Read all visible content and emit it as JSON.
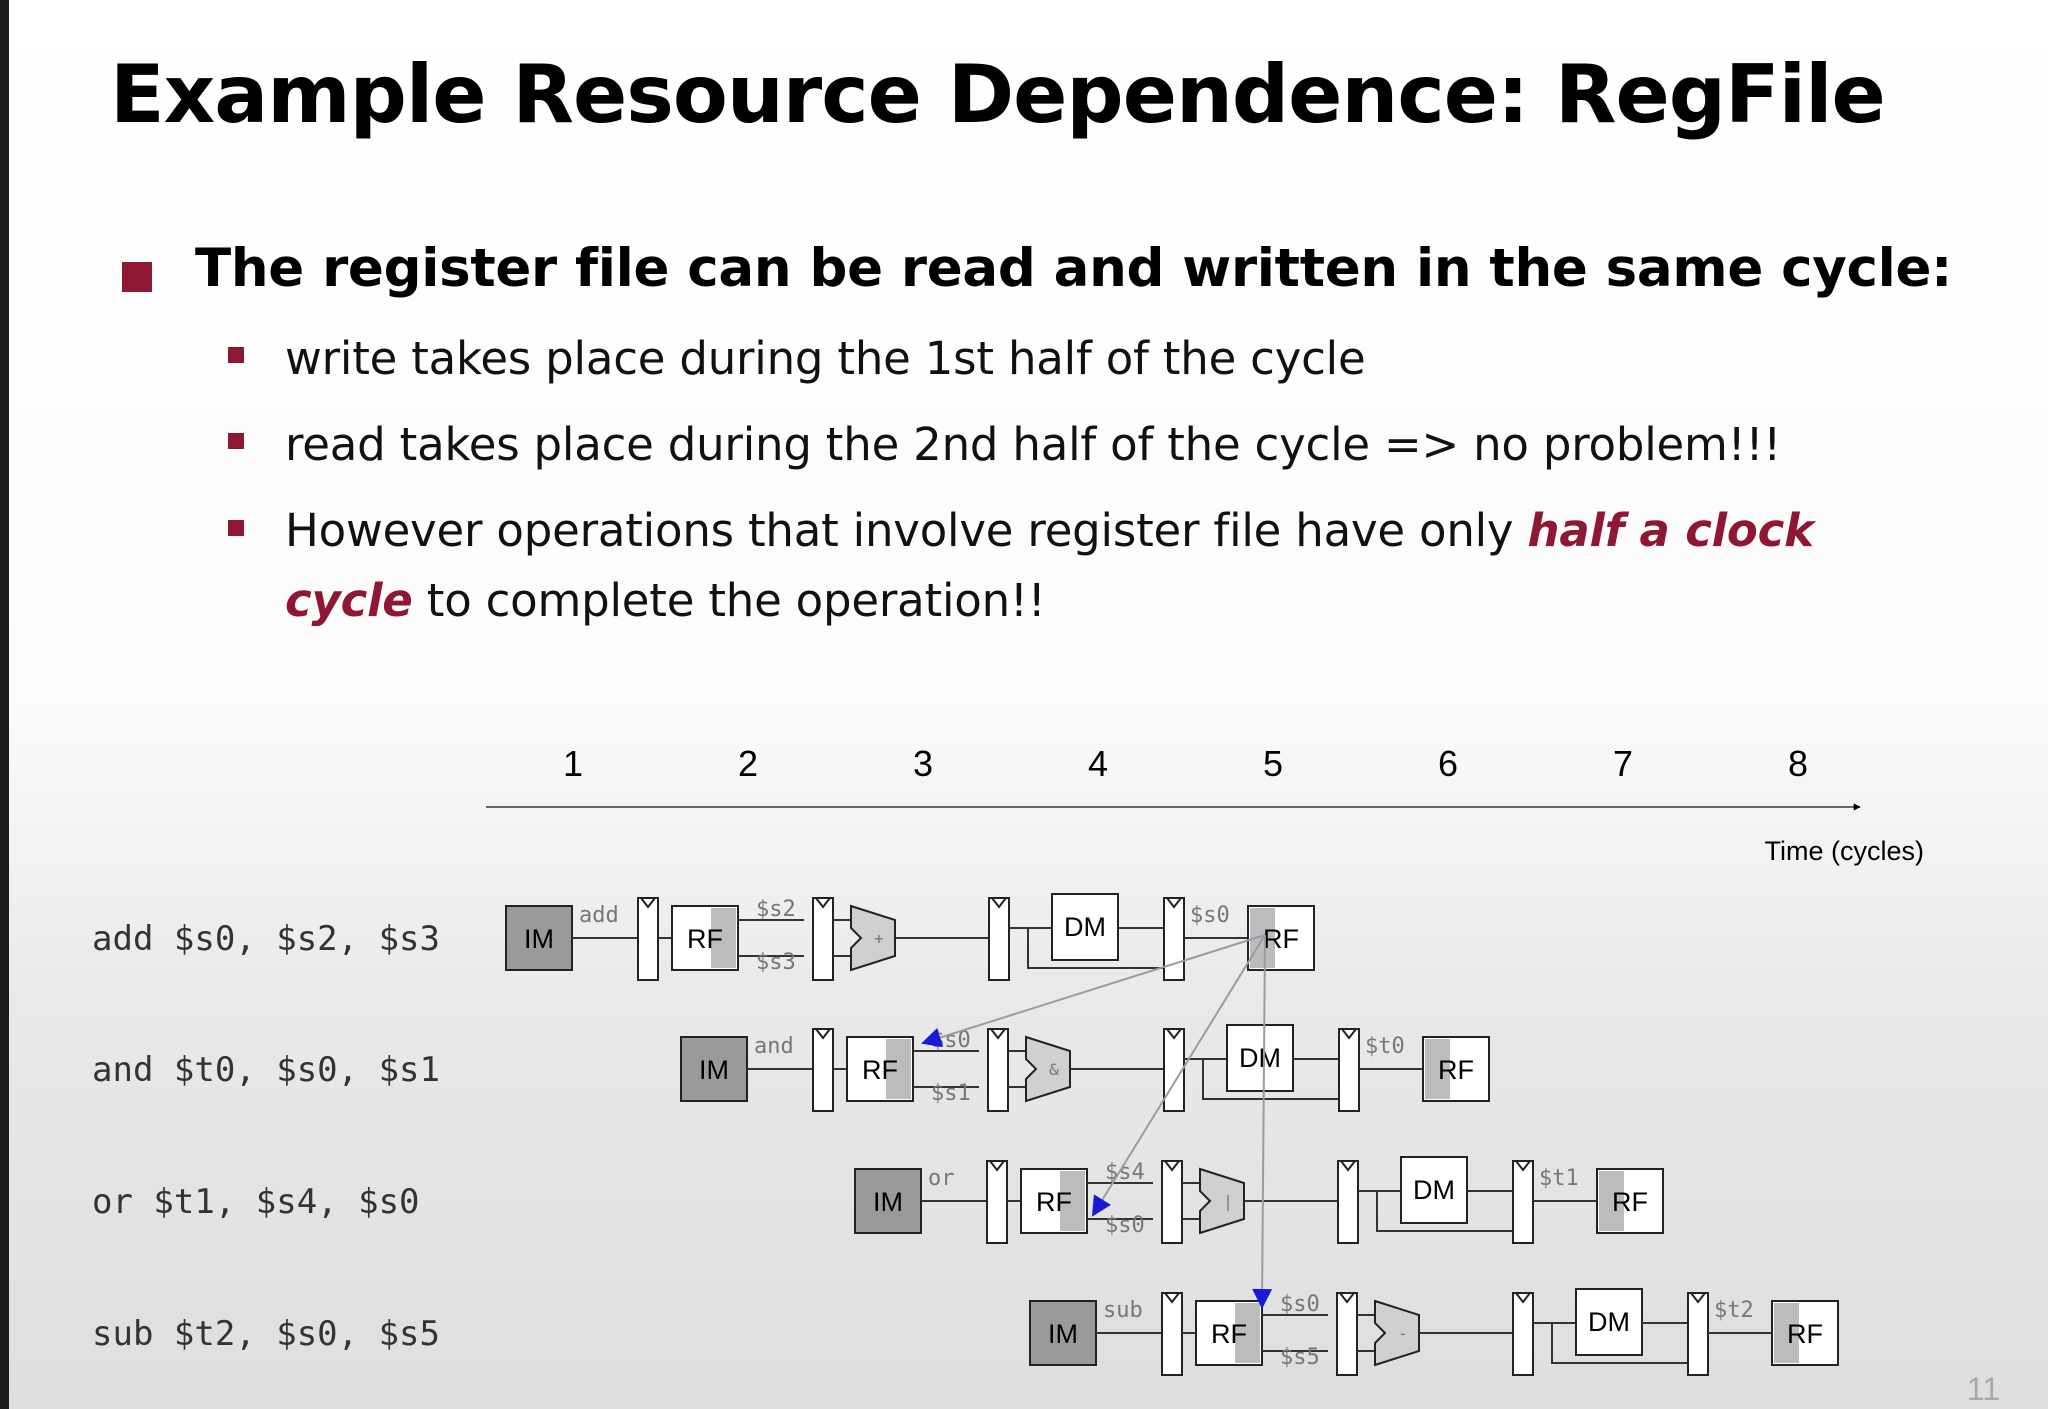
{
  "slide": {
    "title": "Example Resource Dependence: RegFile",
    "main_bullet": "The register file can be read and written in the same cycle:",
    "sub_bullets": {
      "b1": "write takes place during the 1st half of the cycle",
      "b2": "read takes place during the 2nd half of the cycle => no problem!!!",
      "b3_pre": "However operations that involve register file have only ",
      "b3_emph1": "half a clock",
      "b3_emph2": "cycle",
      "b3_post": " to complete the operation!!"
    },
    "page_number": "11"
  },
  "colors": {
    "accent": "#8e1733",
    "forward_arrow": "#1a1ad6"
  },
  "diagram": {
    "cycles": [
      "1",
      "2",
      "3",
      "4",
      "5",
      "6",
      "7",
      "8"
    ],
    "axis_label": "Time (cycles)",
    "block_labels": {
      "im": "IM",
      "rf": "RF",
      "dm": "DM"
    },
    "instructions": [
      {
        "text": "add $s0, $s2, $s3",
        "op": "add",
        "src1": "$s2",
        "src2": "$s3",
        "dst": "$s0",
        "alu": "+"
      },
      {
        "text": "and $t0, $s0, $s1",
        "op": "and",
        "src1": "$s0",
        "src2": "$s1",
        "dst": "$t0",
        "alu": "&"
      },
      {
        "text": "or  $t1, $s4, $s0",
        "op": "or",
        "src1": "$s4",
        "src2": "$s0",
        "dst": "$t1",
        "alu": "|"
      },
      {
        "text": "sub $t2, $s0, $s5",
        "op": "sub",
        "src1": "$s0",
        "src2": "$s5",
        "dst": "$t2",
        "alu": "-"
      }
    ]
  }
}
